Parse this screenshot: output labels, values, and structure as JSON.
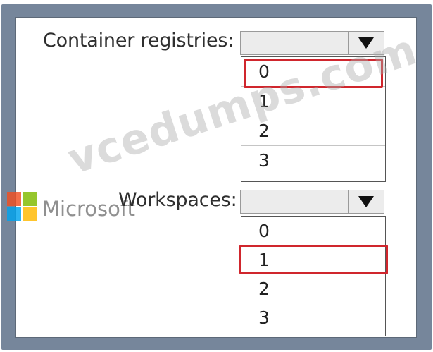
{
  "fields": [
    {
      "label": "Container registries:",
      "selected_value": "",
      "options": [
        "0",
        "1",
        "2",
        "3"
      ],
      "highlighted_option": "0"
    },
    {
      "label": "Workspaces:",
      "selected_value": "",
      "options": [
        "0",
        "1",
        "2",
        "3"
      ],
      "highlighted_option": "1"
    }
  ],
  "icons": {
    "dropdown_arrow": "caret-down-icon",
    "logo": "microsoft-logo-icon"
  },
  "overlay": {
    "brand_text": "Microsoft",
    "watermark_text": "vcedumps.com"
  },
  "colors": {
    "frame": "#76869b",
    "highlight": "#d0262d",
    "dropdown_background": "#ececec"
  }
}
